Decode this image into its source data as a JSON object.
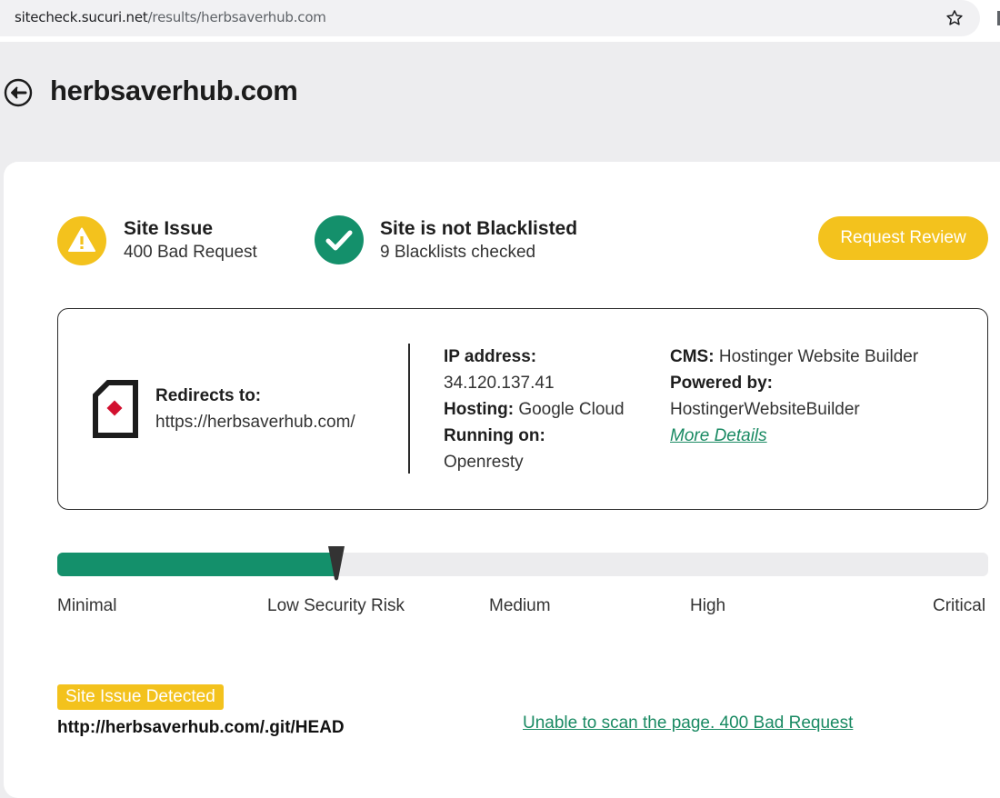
{
  "browser": {
    "url_domain": "sitecheck.sucuri.net",
    "url_path": "/results/herbsaverhub.com",
    "icons": {
      "bookmark": "star-outline-icon"
    }
  },
  "header": {
    "title": "herbsaverhub.com",
    "back_icon": "back-arrow-circle-icon"
  },
  "status": {
    "issue": {
      "title": "Site Issue",
      "subtitle": "400 Bad Request",
      "icon": "warning-icon",
      "color": "#f3c21d"
    },
    "blacklist": {
      "title": "Site is not Blacklisted",
      "subtitle": "9 Blacklists checked",
      "icon": "check-circle-icon",
      "color": "#14906b"
    },
    "request_review_label": "Request Review"
  },
  "site_info": {
    "redirect_label": "Redirects to:",
    "redirect_url": "https://herbsaverhub.com/",
    "ip_label": "IP address:",
    "ip_value": "34.120.137.41",
    "hosting_label": "Hosting:",
    "hosting_value": "Google Cloud",
    "running_label": "Running on:",
    "running_value": "Openresty",
    "cms_label": "CMS:",
    "cms_value": "Hostinger Website Builder",
    "powered_label": "Powered by:",
    "powered_value": "HostingerWebsiteBuilder",
    "more_details": "More Details"
  },
  "risk": {
    "level_fraction": 0.3,
    "labels": [
      "Minimal",
      "Low Security Risk",
      "Medium",
      "High",
      "Critical"
    ],
    "fill_color": "#14906b"
  },
  "issue_detail": {
    "badge": "Site Issue Detected",
    "url": "http://herbsaverhub.com/.git/HEAD",
    "message": "Unable to scan the page. 400 Bad Request"
  }
}
